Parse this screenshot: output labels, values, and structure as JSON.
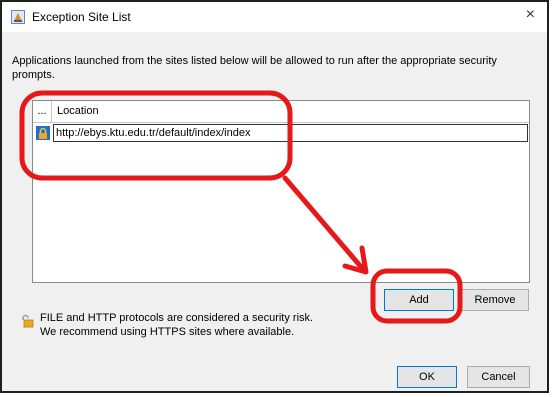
{
  "window": {
    "title": "Exception Site List",
    "close_glyph": "×"
  },
  "description": "Applications launched from the sites listed below will be allowed to run after the appropriate security prompts.",
  "table": {
    "columns": [
      "...",
      "Location"
    ],
    "rows": [
      {
        "location": "http://ebys.ktu.edu.tr/default/index/index",
        "icon": "lock-icon"
      }
    ]
  },
  "buttons": {
    "add": "Add",
    "remove": "Remove",
    "ok": "OK",
    "cancel": "Cancel"
  },
  "warning": {
    "line1": "FILE and HTTP protocols are considered a security risk.",
    "line2": "We recommend using HTTPS sites where available.",
    "icon": "unlocked-padlock-icon"
  },
  "colors": {
    "annotation": "#e51919",
    "focus_border": "#0078d7",
    "dialog_bg": "#f0f0f0"
  }
}
